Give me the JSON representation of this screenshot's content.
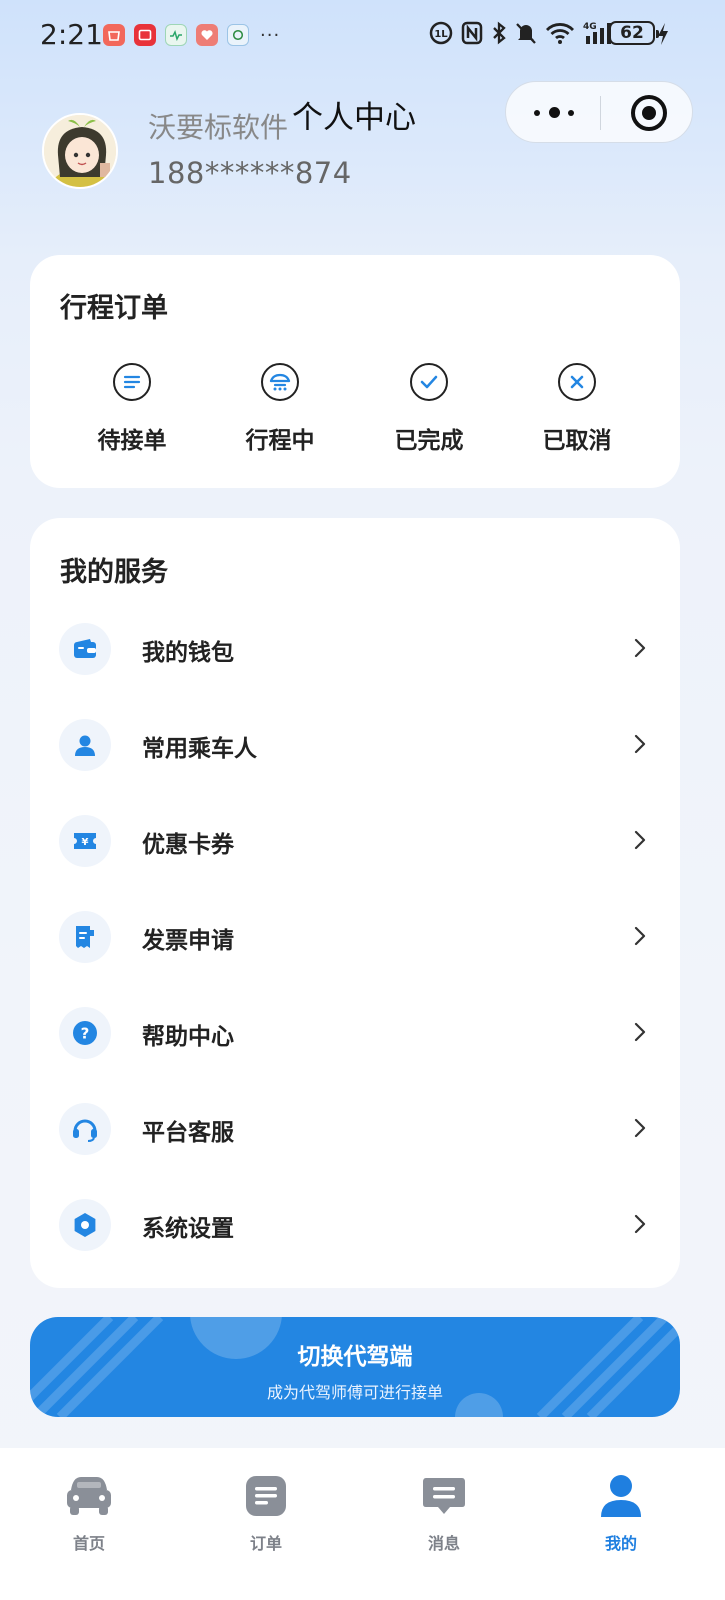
{
  "status_bar": {
    "time": "2:21",
    "more": "···",
    "battery": "62"
  },
  "header": {
    "username": "沃要标软件",
    "phone": "188******874",
    "title": "个人中心"
  },
  "orders": {
    "title": "行程订单",
    "items": [
      {
        "label": "待接单",
        "icon": "list-circle-icon"
      },
      {
        "label": "行程中",
        "icon": "car-circle-icon"
      },
      {
        "label": "已完成",
        "icon": "check-circle-icon"
      },
      {
        "label": "已取消",
        "icon": "x-circle-icon"
      }
    ]
  },
  "services": {
    "title": "我的服务",
    "items": [
      {
        "label": "我的钱包",
        "icon": "wallet-icon"
      },
      {
        "label": "常用乘车人",
        "icon": "person-icon"
      },
      {
        "label": "优惠卡券",
        "icon": "coupon-icon"
      },
      {
        "label": "发票申请",
        "icon": "invoice-icon"
      },
      {
        "label": "帮助中心",
        "icon": "help-icon"
      },
      {
        "label": "平台客服",
        "icon": "headset-icon"
      },
      {
        "label": "系统设置",
        "icon": "settings-icon"
      }
    ]
  },
  "switch_banner": {
    "title": "切换代驾端",
    "subtitle": "成为代驾师傅可进行接单"
  },
  "bottom_nav": {
    "items": [
      {
        "label": "首页",
        "icon": "car-icon",
        "active": false
      },
      {
        "label": "订单",
        "icon": "document-icon",
        "active": false
      },
      {
        "label": "消息",
        "icon": "message-icon",
        "active": false
      },
      {
        "label": "我的",
        "icon": "user-icon",
        "active": true
      }
    ]
  },
  "colors": {
    "accent": "#2386e2",
    "active_nav": "#1f7fe0",
    "inactive_nav": "#8a8f98"
  }
}
